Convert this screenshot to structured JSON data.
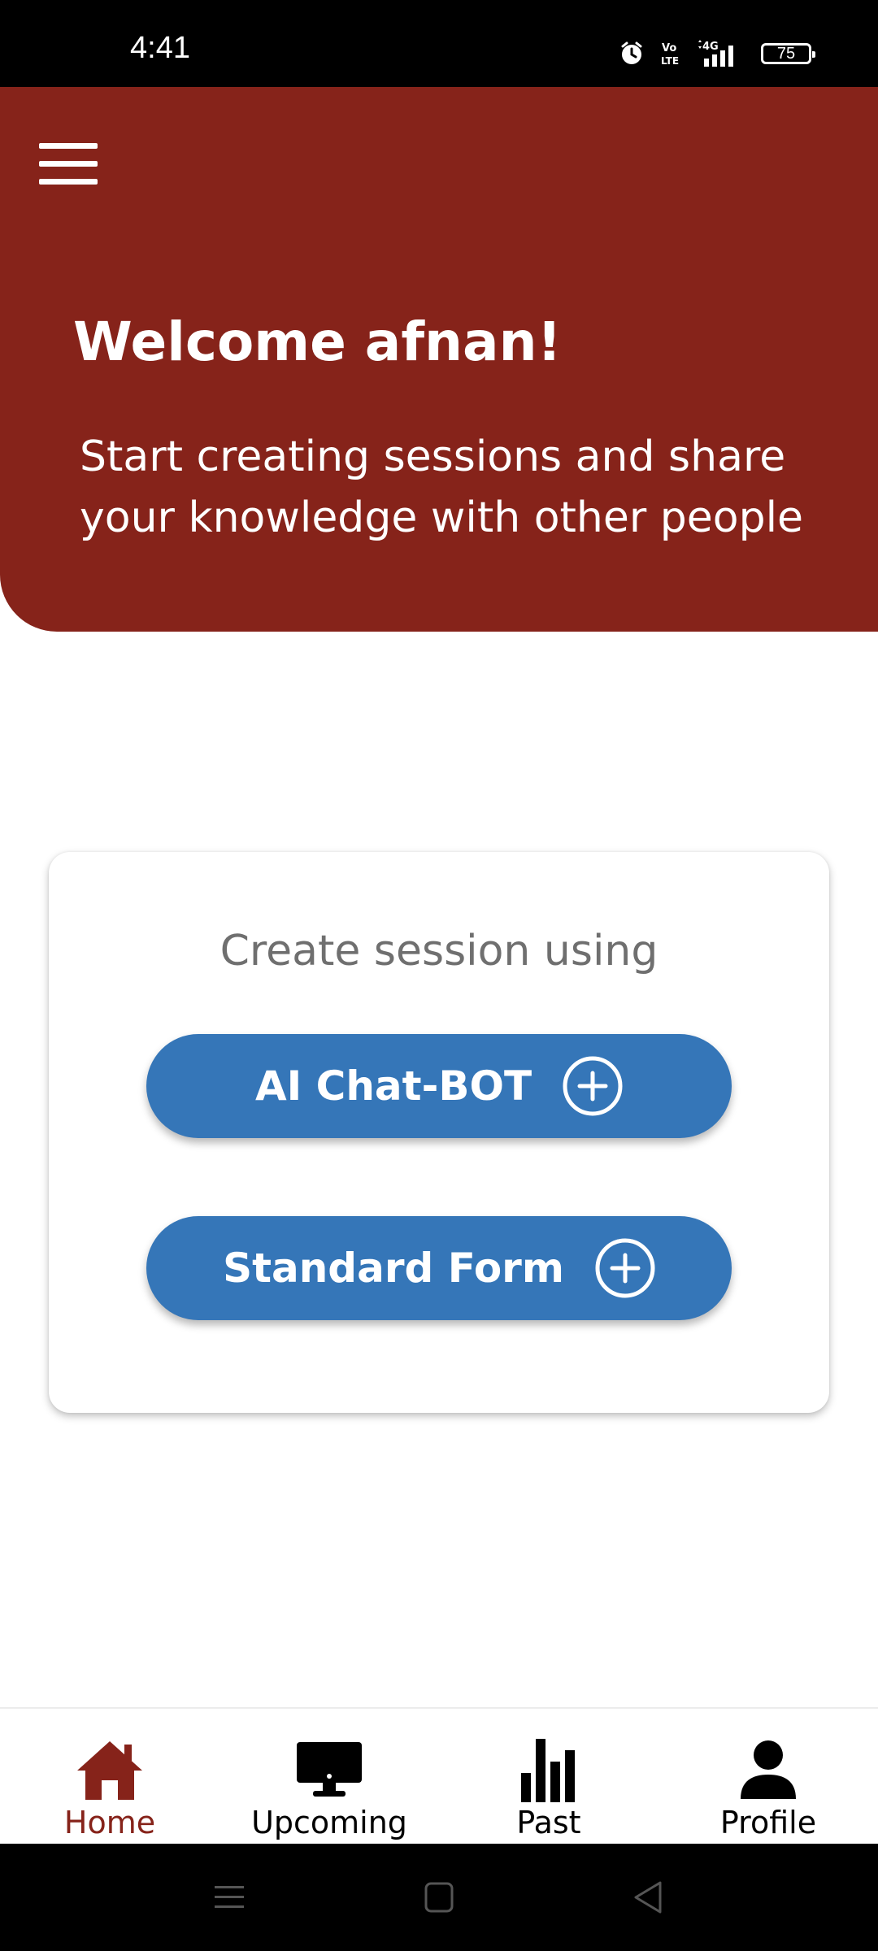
{
  "status_bar": {
    "time": "4:41",
    "battery": "75",
    "icons": [
      "alarm-icon",
      "volte-icon",
      "signal-4g-icon",
      "battery-icon"
    ]
  },
  "header": {
    "menu_icon": "hamburger-menu-icon",
    "title": "Welcome afnan!",
    "subtitle": "Start creating sessions and share your knowledge with other people",
    "background_color": "#86231a"
  },
  "card": {
    "title": "Create session using",
    "buttons": [
      {
        "label": "AI Chat-BOT",
        "icon": "plus-circle-icon"
      },
      {
        "label": "Standard Form",
        "icon": "plus-circle-icon"
      }
    ],
    "button_color": "#3576b8"
  },
  "bottom_nav": {
    "active": "Home",
    "active_color": "#86231a",
    "items": [
      {
        "label": "Home",
        "icon": "home-icon"
      },
      {
        "label": "Upcoming",
        "icon": "monitor-icon"
      },
      {
        "label": "Past",
        "icon": "bar-chart-icon"
      },
      {
        "label": "Profile",
        "icon": "person-icon"
      }
    ]
  },
  "system_nav": {
    "buttons": [
      "recents-icon",
      "home-square-icon",
      "back-triangle-icon"
    ]
  }
}
